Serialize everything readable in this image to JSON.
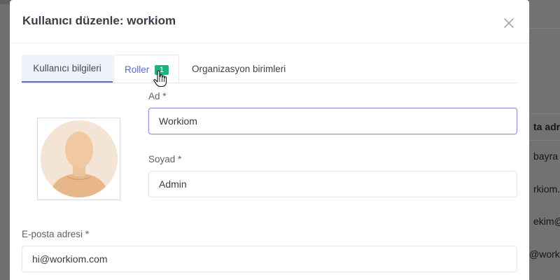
{
  "background": {
    "column_header": "ta adre",
    "rows": [
      "bayra",
      "rkiom.",
      "ekim@",
      "@work"
    ]
  },
  "modal": {
    "title": "Kullanıcı düzenle: workiom",
    "close_symbol": "×"
  },
  "tabs": [
    {
      "label": "Kullanıcı bilgileri",
      "active": true
    },
    {
      "label": "Roller",
      "badge": "1",
      "active": false
    },
    {
      "label": "Organizasyon birimleri",
      "active": false
    }
  ],
  "form": {
    "first_name": {
      "label": "Ad *",
      "value": "Workiom"
    },
    "last_name": {
      "label": "Soyad *",
      "value": "Admin"
    },
    "email": {
      "label": "E-posta adresi *",
      "value": "hi@workiom.com"
    }
  },
  "icons": {
    "close": "close-icon",
    "avatar": "user-avatar-icon",
    "cursor": "hand-pointer-icon"
  },
  "colors": {
    "accent": "#5867dd",
    "badge": "#1bb47f",
    "overlay": "#707072"
  }
}
